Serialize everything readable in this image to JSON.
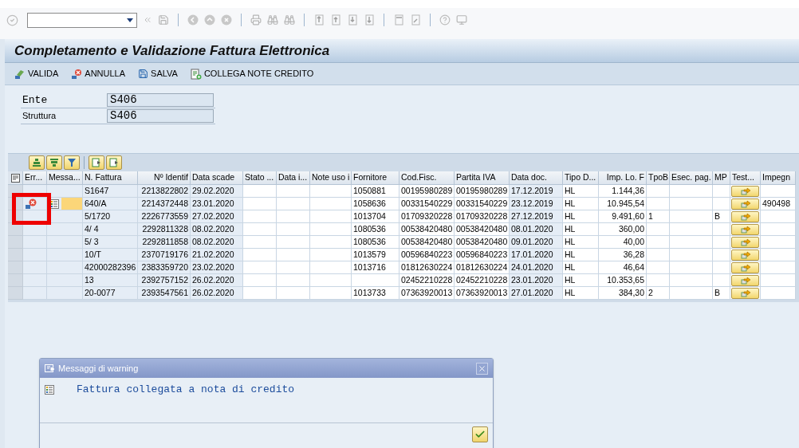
{
  "title": "Completamento e Validazione Fattura Elettronica",
  "app_toolbar": [
    {
      "kind": "valida",
      "label": "VALIDA"
    },
    {
      "kind": "annulla",
      "label": "ANNULLA"
    },
    {
      "kind": "salva",
      "label": "SALVA"
    },
    {
      "kind": "collega",
      "label": "COLLEGA NOTE CREDITO"
    }
  ],
  "fields": [
    {
      "label": "Ente",
      "value": "S406",
      "mono": true
    },
    {
      "label": "Struttura",
      "value": "S406",
      "mono": false
    }
  ],
  "table": {
    "columns": [
      "Err...",
      "Messa...",
      "N. Fattura",
      "Nº Identif",
      "Data scade",
      "Stato ...",
      "Data i...",
      "Note uso i",
      "Fornitore",
      "Cod.Fisc.",
      "Partita IVA",
      "Data doc.",
      "Tipo D...",
      "Imp. Lo. F",
      "TpoB",
      "Esec. pag.",
      "MP",
      "Test...",
      "Impegn"
    ],
    "rows": [
      {
        "error": false,
        "message": false,
        "cells": {
          "n_fattura": "S1647",
          "n_identif": "2213822802",
          "data_scade": "29.02.2020",
          "fornitore": "1050881",
          "cod_fisc": "00195980289",
          "partita_iva": "00195980289",
          "data_doc": "17.12.2019",
          "tipo_doc": "HL",
          "importo": "1.144,36"
        }
      },
      {
        "error": true,
        "message": true,
        "cells": {
          "n_fattura": "640/A",
          "n_identif": "2214372448",
          "data_scade": "23.01.2020",
          "fornitore": "1058636",
          "cod_fisc": "00331540229",
          "partita_iva": "00331540229",
          "data_doc": "23.12.2019",
          "tipo_doc": "HL",
          "importo": "10.945,54",
          "impegno": "490498"
        }
      },
      {
        "error": false,
        "message": false,
        "cells": {
          "n_fattura": "5/1720",
          "n_identif": "2226773559",
          "data_scade": "27.02.2020",
          "fornitore": "1013704",
          "cod_fisc": "01709320228",
          "partita_iva": "01709320228",
          "data_doc": "27.12.2019",
          "tipo_doc": "HL",
          "importo": "9.491,60",
          "tpob": "1",
          "mp": "B"
        }
      },
      {
        "error": false,
        "message": false,
        "cells": {
          "n_fattura": "4/ 4",
          "n_identif": "2292811328",
          "data_scade": "08.02.2020",
          "fornitore": "1080536",
          "cod_fisc": "00538420480",
          "partita_iva": "00538420480",
          "data_doc": "08.01.2020",
          "tipo_doc": "HL",
          "importo": "360,00"
        }
      },
      {
        "error": false,
        "message": false,
        "cells": {
          "n_fattura": "5/ 3",
          "n_identif": "2292811858",
          "data_scade": "08.02.2020",
          "fornitore": "1080536",
          "cod_fisc": "00538420480",
          "partita_iva": "00538420480",
          "data_doc": "09.01.2020",
          "tipo_doc": "HL",
          "importo": "40,00"
        }
      },
      {
        "error": false,
        "message": false,
        "cells": {
          "n_fattura": "10/T",
          "n_identif": "2370719176",
          "data_scade": "21.02.2020",
          "fornitore": "1013579",
          "cod_fisc": "00596840223",
          "partita_iva": "00596840223",
          "data_doc": "17.01.2020",
          "tipo_doc": "HL",
          "importo": "36,28"
        }
      },
      {
        "error": false,
        "message": false,
        "cells": {
          "n_fattura": "42000282396",
          "n_identif": "2383359720",
          "data_scade": "23.02.2020",
          "fornitore": "1013716",
          "cod_fisc": "01812630224",
          "partita_iva": "01812630224",
          "data_doc": "24.01.2020",
          "tipo_doc": "HL",
          "importo": "46,64"
        }
      },
      {
        "error": false,
        "message": false,
        "cells": {
          "n_fattura": "13",
          "n_identif": "2392757152",
          "data_scade": "26.02.2020",
          "cod_fisc": "02452210228",
          "partita_iva": "02452210228",
          "data_doc": "23.01.2020",
          "tipo_doc": "HL",
          "importo": "10.353,65"
        }
      },
      {
        "error": false,
        "message": false,
        "cells": {
          "n_fattura": "20-0077",
          "n_identif": "2393547561",
          "data_scade": "26.02.2020",
          "fornitore": "1013733",
          "cod_fisc": "07363920013",
          "partita_iva": "07363920013",
          "data_doc": "27.01.2020",
          "tipo_doc": "HL",
          "importo": "384,30",
          "tpob": "2",
          "mp": "B"
        }
      }
    ]
  },
  "dialog": {
    "title": "Messaggi di warning",
    "message": "Fattura collegata a nota di credito"
  }
}
